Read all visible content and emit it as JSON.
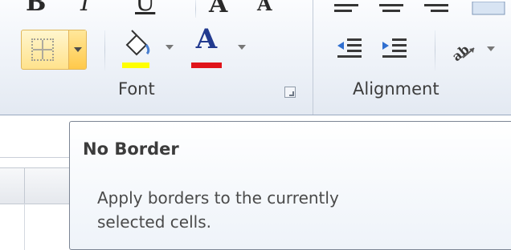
{
  "ribbon": {
    "font_group": {
      "label": "Font",
      "top_glyphs": [
        "B",
        "I",
        "U",
        "A",
        "A"
      ],
      "borders_button": {
        "icon": "no-border-grid-icon"
      },
      "fill_color": {
        "icon": "paint-bucket-icon",
        "color": "#ffff00"
      },
      "font_color": {
        "label": "A",
        "color": "#e0141a"
      }
    },
    "alignment_group": {
      "label": "Alignment",
      "icons": [
        "align-left-icon",
        "align-center-icon",
        "align-right-icon",
        "decrease-indent-icon",
        "increase-indent-icon",
        "orientation-icon"
      ]
    }
  },
  "tooltip": {
    "title": "No Border",
    "lines": [
      "Apply borders to the currently",
      "selected cells."
    ]
  }
}
